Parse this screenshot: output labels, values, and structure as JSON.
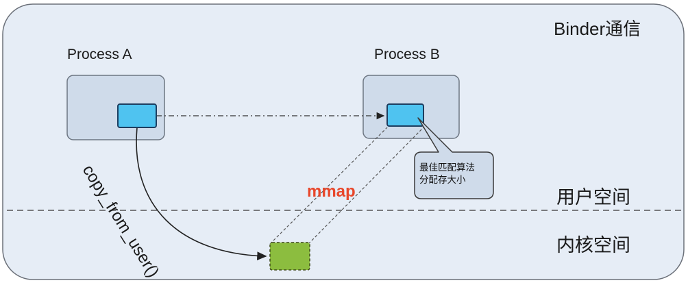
{
  "diagram": {
    "title": "Binder通信",
    "process_a_label": "Process A",
    "process_b_label": "Process B",
    "user_space_label": "用户空间",
    "kernel_space_label": "内核空间",
    "mmap_label": "mmap",
    "copy_label": "copy_from_user()",
    "callout_line1": "最佳匹配算法",
    "callout_line2": "分配存大小"
  },
  "colors": {
    "frame_fill": "#e6edf6",
    "process_fill": "#cfdbea",
    "buffer_blue": "#4fc3f0",
    "kernel_buffer_green": "#8cbd3f",
    "mmap_red": "#e8472b"
  }
}
